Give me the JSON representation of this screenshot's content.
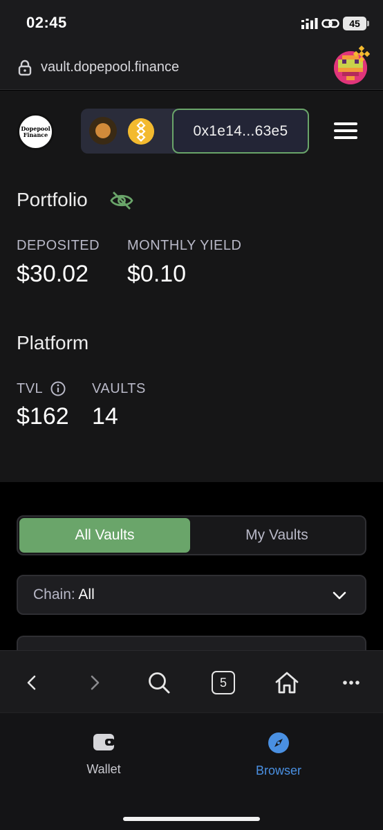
{
  "status_bar": {
    "time": "02:45",
    "battery": "45"
  },
  "browser": {
    "url": "vault.dopepool.finance",
    "tab_count": "5"
  },
  "app": {
    "logo_text": "Dopepool Finance",
    "wallet_address": "0x1e14...63e5",
    "portfolio": {
      "title": "Portfolio",
      "deposited_label": "DEPOSITED",
      "deposited_value": "$30.02",
      "monthly_yield_label": "MONTHLY YIELD",
      "monthly_yield_value": "$0.10"
    },
    "platform": {
      "title": "Platform",
      "tvl_label": "TVL",
      "tvl_value": "$162",
      "vaults_label": "VAULTS",
      "vaults_value": "14"
    },
    "tabs": {
      "all": "All Vaults",
      "mine": "My Vaults",
      "active": "All Vaults"
    },
    "chain_filter": {
      "label": "Chain:",
      "value": "All"
    }
  },
  "bottom_nav": {
    "wallet": "Wallet",
    "browser": "Browser",
    "active": "Browser"
  },
  "colors": {
    "accent": "#6aa56a",
    "browser_blue": "#4a90e2",
    "bnb": "#f3ba2f"
  }
}
